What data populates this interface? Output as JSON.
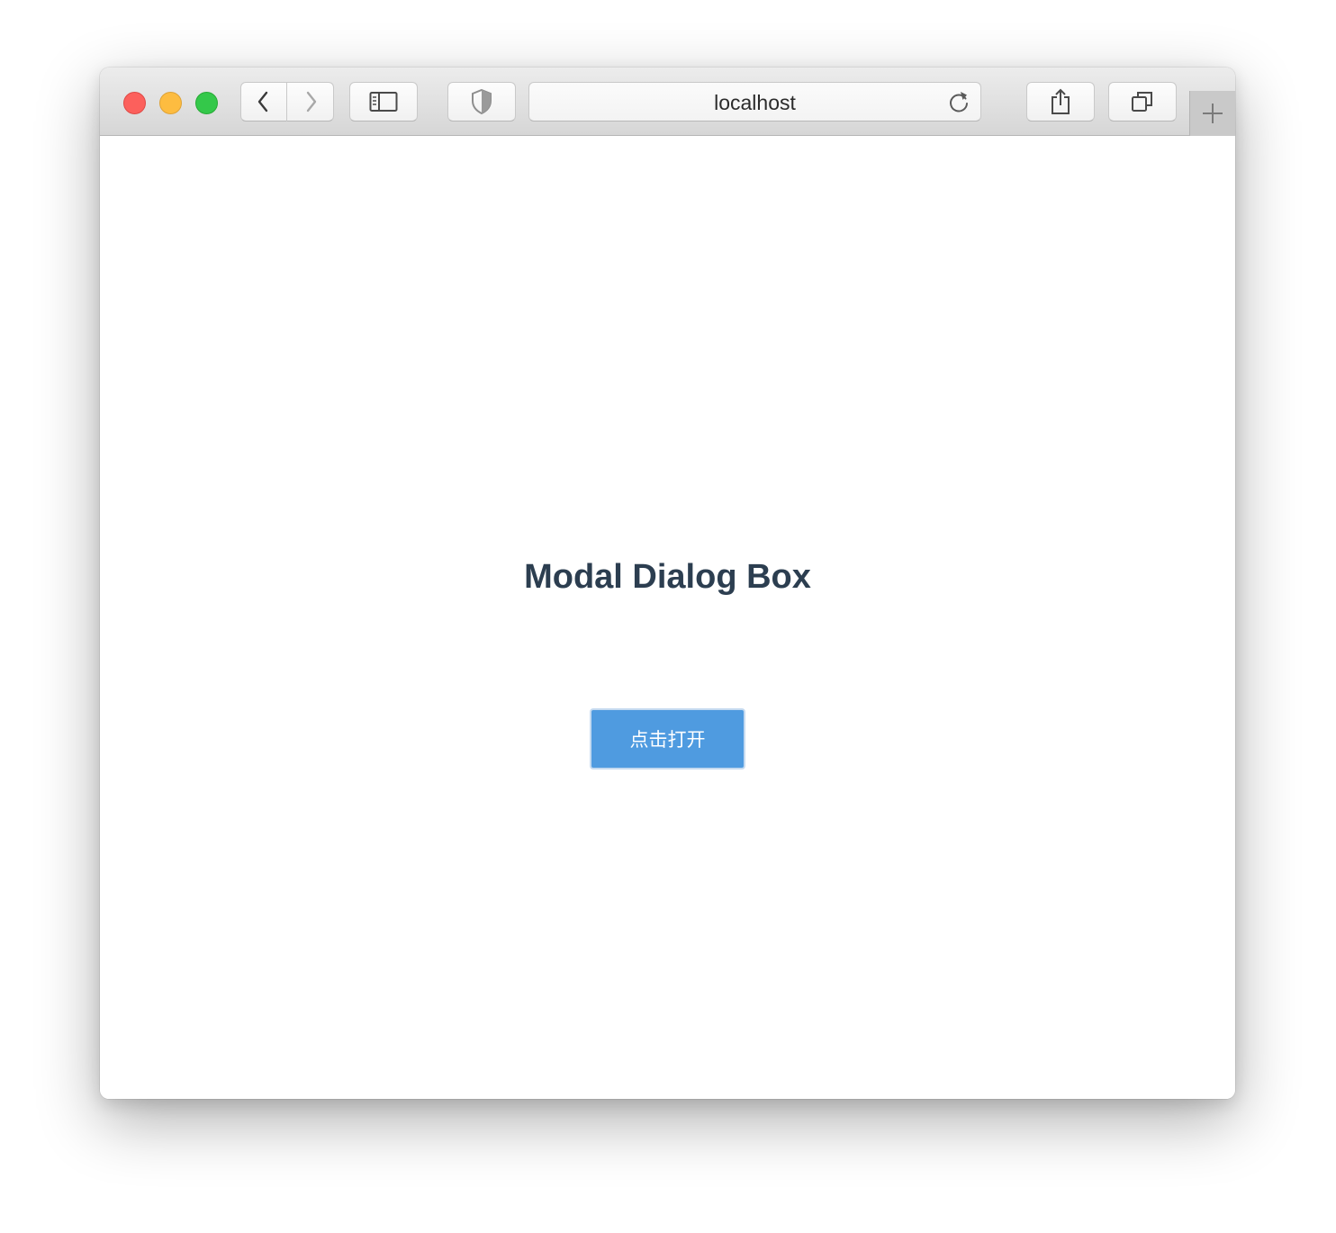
{
  "browser": {
    "address_text": "localhost",
    "icons": {
      "back": "chevron-left-icon",
      "forward": "chevron-right-icon",
      "sidebar": "sidebar-icon",
      "privacy": "shield-icon",
      "reload": "reload-icon",
      "share": "share-icon",
      "tabs": "tabs-overview-icon",
      "new_tab": "plus-icon"
    },
    "traffic_light_colors": {
      "close": "#fc605c",
      "minimize": "#fdbc40",
      "zoom": "#34c84a"
    }
  },
  "page": {
    "title": "Modal Dialog Box",
    "open_button_label": "点击打开",
    "title_color": "#2c3e50",
    "button_color": "#4f9be0"
  }
}
